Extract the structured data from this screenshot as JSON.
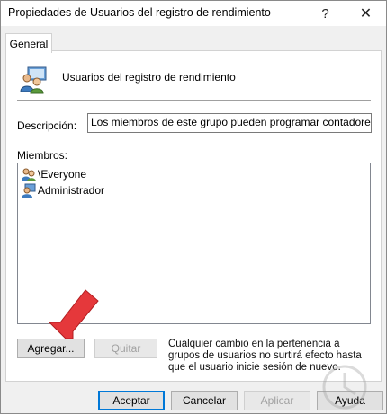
{
  "window": {
    "title": "Propiedades de Usuarios del registro de rendimiento",
    "help_glyph": "?",
    "close_glyph": "✕"
  },
  "tabs": [
    {
      "label": "General"
    }
  ],
  "group": {
    "name": "Usuarios del registro de rendimiento",
    "description_label": "Descripción:",
    "description_value": "Los miembros de este grupo pueden programar contadores de",
    "members_label": "Miembros:",
    "members": [
      {
        "name": "\\Everyone",
        "icon": "group-icon"
      },
      {
        "name": "Administrador",
        "icon": "user-icon"
      }
    ]
  },
  "actions": {
    "add_label": "Agregar...",
    "remove_label": "Quitar",
    "note": "Cualquier cambio en la pertenencia a grupos de usuarios no surtirá efecto hasta que el usuario inicie sesión de nuevo."
  },
  "footer": {
    "accept_label": "Aceptar",
    "cancel_label": "Cancelar",
    "apply_label": "Aplicar",
    "help_label": "Ayuda"
  },
  "colors": {
    "accent": "#0078d7",
    "arrow": "#e5383b"
  }
}
